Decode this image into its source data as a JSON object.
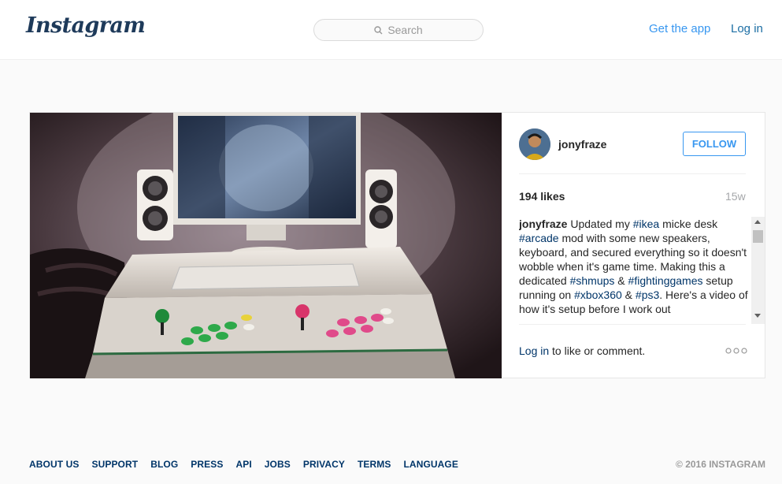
{
  "header": {
    "logo_text": "Instagram",
    "search_placeholder": "Search",
    "get_app_label": "Get the app",
    "login_label": "Log in"
  },
  "post": {
    "username": "jonyfraze",
    "follow_label": "FOLLOW",
    "likes": "194 likes",
    "time_ago": "15w",
    "caption": {
      "author": "jonyfraze",
      "segments": [
        {
          "text": " Updated my ",
          "tag": false
        },
        {
          "text": "#ikea",
          "tag": true
        },
        {
          "text": " micke desk ",
          "tag": false
        },
        {
          "text": "#arcade",
          "tag": true
        },
        {
          "text": " mod with some new speakers, keyboard, and secured everything so it doesn't wobble when it's game time. Making this a dedicated ",
          "tag": false
        },
        {
          "text": "#shmups",
          "tag": true
        },
        {
          "text": " & ",
          "tag": false
        },
        {
          "text": "#fightinggames",
          "tag": true
        },
        {
          "text": " setup running on ",
          "tag": false
        },
        {
          "text": "#xbox360",
          "tag": true
        },
        {
          "text": " & ",
          "tag": false
        },
        {
          "text": "#ps3",
          "tag": true
        },
        {
          "text": ". Here's a video of how it's setup before I work out ",
          "tag": false
        }
      ]
    },
    "login_link": "Log in",
    "login_suffix": " to like or comment."
  },
  "footer": {
    "links": [
      "ABOUT US",
      "SUPPORT",
      "BLOG",
      "PRESS",
      "API",
      "JOBS",
      "PRIVACY",
      "TERMS",
      "LANGUAGE"
    ],
    "copyright": "© 2016 INSTAGRAM"
  },
  "colors": {
    "link_blue": "#3897f0",
    "dark_blue": "#003569",
    "border": "#efefef"
  }
}
